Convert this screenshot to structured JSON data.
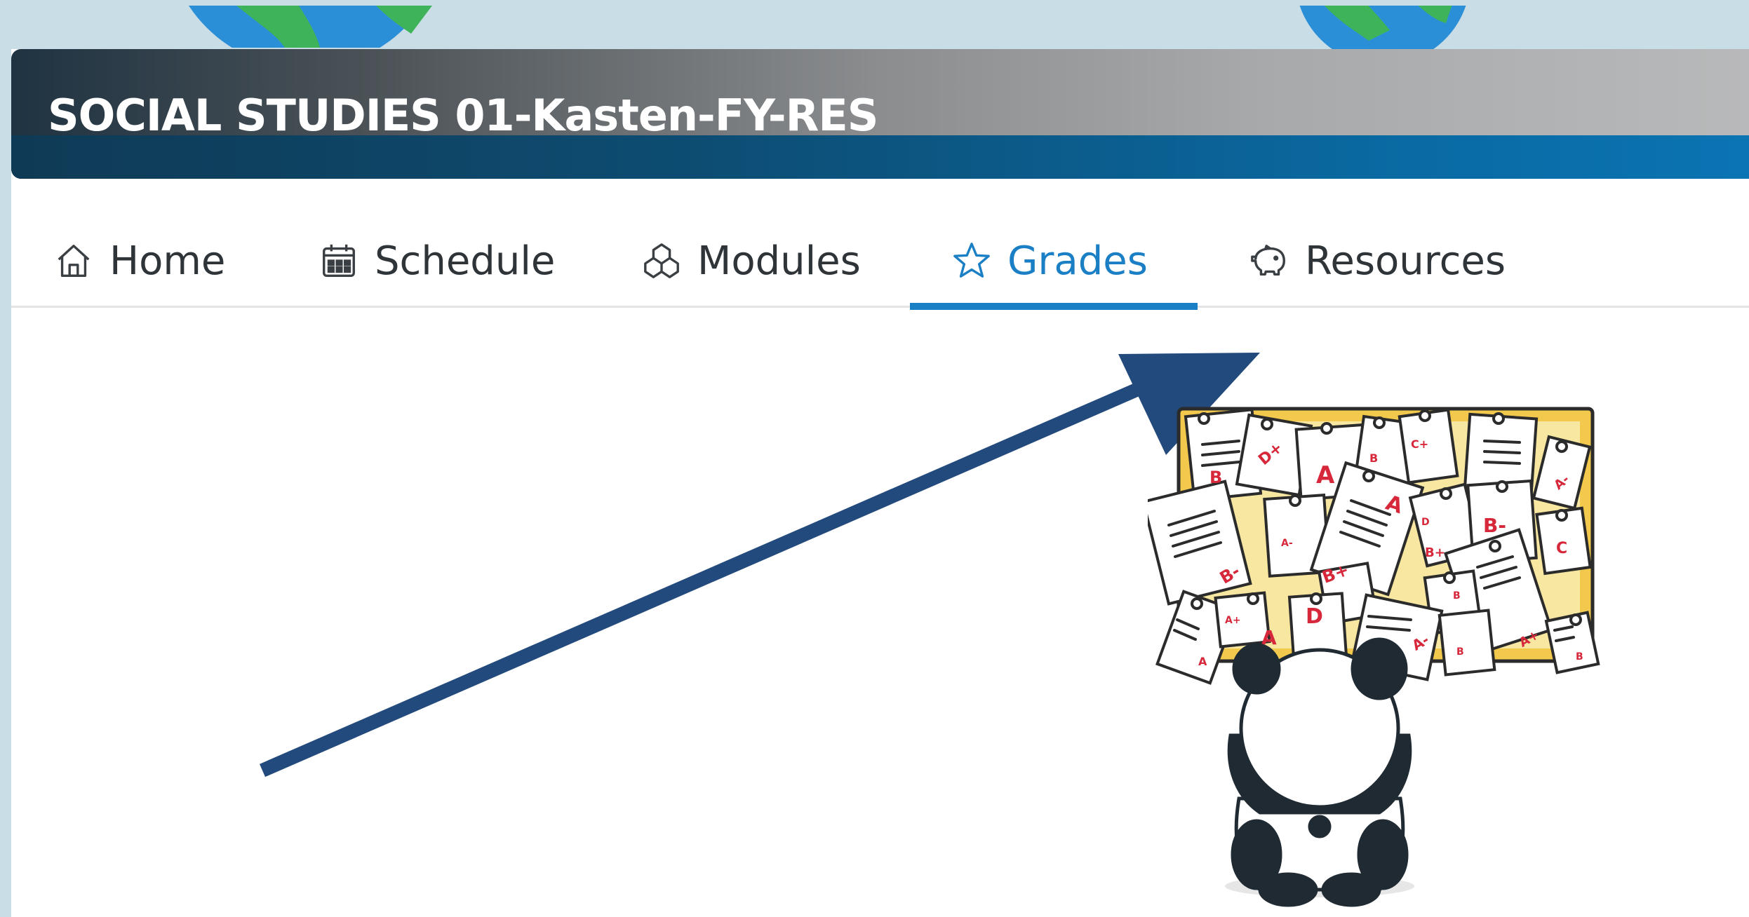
{
  "course": {
    "title": "SOCIAL STUDIES 01-Kasten-FY-RES"
  },
  "tabs": [
    {
      "label": "Home",
      "icon": "home-icon",
      "active": false
    },
    {
      "label": "Schedule",
      "icon": "calendar-icon",
      "active": false
    },
    {
      "label": "Modules",
      "icon": "modules-icon",
      "active": false
    },
    {
      "label": "Grades",
      "icon": "star-icon",
      "active": true
    },
    {
      "label": "Resources",
      "icon": "piggy-bank-icon",
      "active": false
    }
  ],
  "illustration": {
    "grade_labels": [
      "B",
      "D+",
      "A",
      "B",
      "C+",
      "A",
      "A-",
      "A",
      "D",
      "B-",
      "A-",
      "B+",
      "B",
      "C",
      "B-",
      "A+",
      "A",
      "D",
      "A-",
      "B",
      "A+",
      "B",
      "A"
    ]
  },
  "colors": {
    "accent": "#1a7fc4",
    "arrow": "#234a7c",
    "grade_red": "#d6283a",
    "board_frame": "#f2c94c"
  }
}
